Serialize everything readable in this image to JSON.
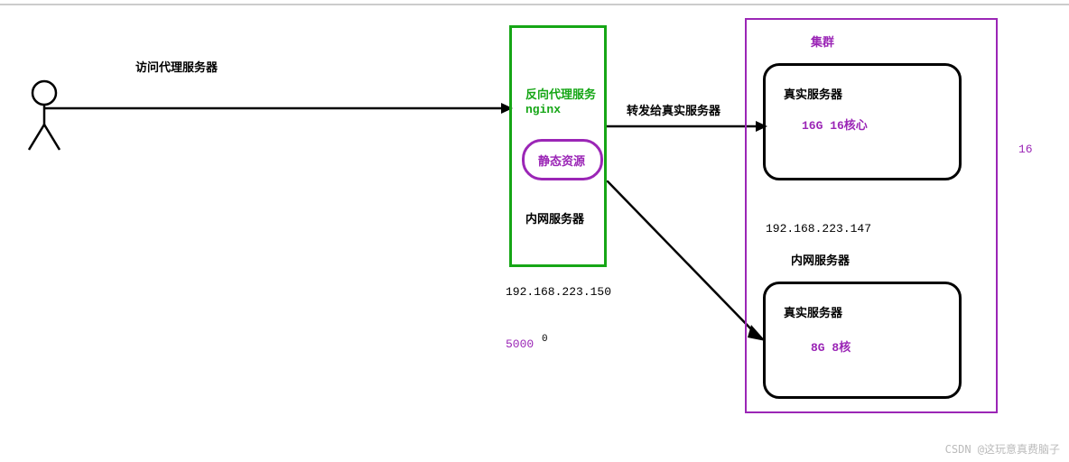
{
  "labels": {
    "access_proxy": "访问代理服务器",
    "reverse_proxy": "反向代理服务",
    "nginx": "nginx",
    "static_res": "静态资源",
    "intranet_server_left": "内网服务器",
    "ip_left": "192.168.223.150",
    "forward_real": "转发给真实服务器",
    "cluster": "集群",
    "real_server1_title": "真实服务器",
    "real_server1_spec": "16G 16核心",
    "ip_right": "192.168.223.147",
    "intranet_server_right": "内网服务器",
    "real_server2_title": "真实服务器",
    "real_server2_spec": "8G  8核",
    "five_thousand": "5000",
    "zero_sup": "0",
    "sixteen": "16"
  },
  "watermark": "CSDN @这玩意真费脑子"
}
